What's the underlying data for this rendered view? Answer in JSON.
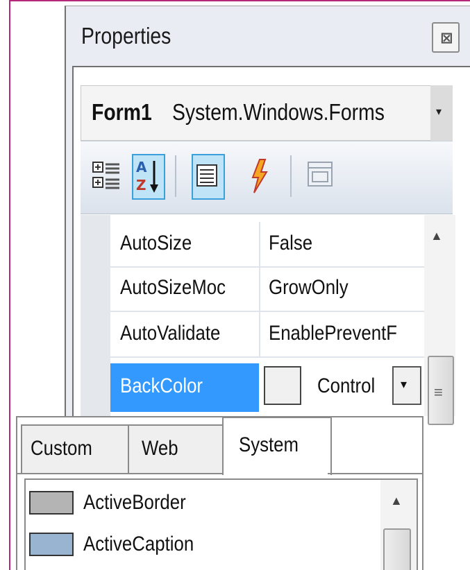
{
  "panel": {
    "title": "Properties",
    "close_glyph": "⊠"
  },
  "object_selector": {
    "name": "Form1",
    "type": "System.Windows.Forms",
    "dropdown_glyph": "▾"
  },
  "toolbar": {
    "buttons": [
      {
        "icon": "categorized-icon",
        "selected": false
      },
      {
        "icon": "alphabetical-sort-icon",
        "selected": true
      },
      {
        "icon": "properties-icon",
        "selected": true
      },
      {
        "icon": "events-lightning-icon",
        "selected": false
      },
      {
        "icon": "property-pages-icon",
        "selected": false
      }
    ]
  },
  "properties": [
    {
      "name": "AutoSize",
      "value": "False"
    },
    {
      "name": "AutoSizeMoc",
      "value": "GrowOnly"
    },
    {
      "name": "AutoValidate",
      "value": "EnablePreventF"
    },
    {
      "name": "BackColor",
      "value": "Control",
      "selected": true
    }
  ],
  "scrollbar": {
    "up_glyph": "▲",
    "grip_glyph": "≡"
  },
  "backcolor_dropdown_glyph": "▾",
  "color_picker": {
    "tabs": [
      {
        "label": "Custom",
        "active": false
      },
      {
        "label": "Web",
        "active": false
      },
      {
        "label": "System",
        "active": true
      }
    ],
    "items": [
      {
        "label": "ActiveBorder",
        "color": "#b4b4b4"
      },
      {
        "label": "ActiveCaption",
        "color": "#99b4d1"
      }
    ],
    "scroll_up_glyph": "▲"
  },
  "colors": {
    "selection": "#3399ff",
    "frame_accent": "#b4287c"
  }
}
